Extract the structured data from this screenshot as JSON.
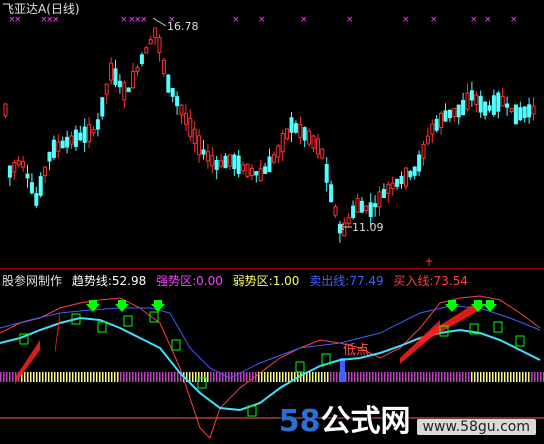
{
  "header": {
    "stock_name": "飞亚达A",
    "period": "(日线)"
  },
  "price_labels": {
    "high": "16.78",
    "low": "11.09"
  },
  "indicator": {
    "author": "股参网制作",
    "trend_line": "趋势线:52.98",
    "strong_zone": "强势区:0.00",
    "weak_zone": "弱势区:1.00",
    "sell_line": "卖出线:77.49",
    "buy_line": "买入线:73.54",
    "low_point": "低点"
  },
  "watermark": {
    "logo_58": "58",
    "logo_rest": "公式网",
    "url": "www.58gu.com"
  },
  "colors": {
    "bg": "#000000",
    "up": "#ff3030",
    "down": "#54ffff",
    "magenta": "#ff40ff",
    "trend": "#ffffff",
    "strong": "#00ff00",
    "weak": "#ffff00",
    "sell": "#4060ff",
    "buy": "#ff3030"
  }
}
